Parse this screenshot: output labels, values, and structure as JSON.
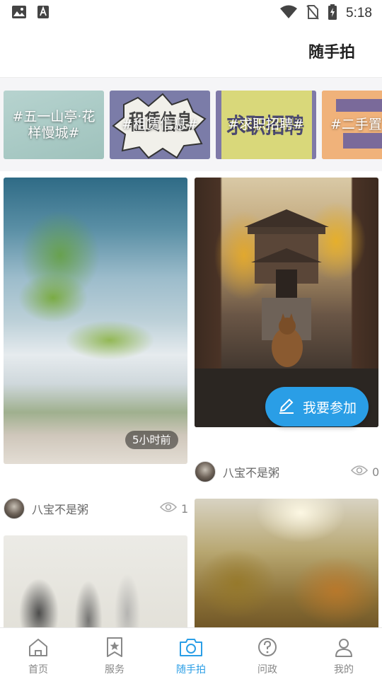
{
  "status_bar": {
    "time": "5:18"
  },
  "header": {
    "title": "随手拍"
  },
  "topics": [
    {
      "label": "#五一山亭·花样慢城#"
    },
    {
      "label": "#租赁信息#",
      "art_text": "租赁信息"
    },
    {
      "label": "#求职招聘#",
      "art_text": "求职招聘"
    },
    {
      "label": "#二手置"
    }
  ],
  "posts": [
    {
      "time": "5小时前",
      "author": "八宝不是粥",
      "views": "1"
    },
    {
      "author": "八宝不是粥",
      "views": "0"
    }
  ],
  "join_button": {
    "label": "我要参加"
  },
  "tabs": [
    {
      "label": "首页",
      "icon": "home-icon"
    },
    {
      "label": "服务",
      "icon": "star-bookmark-icon"
    },
    {
      "label": "随手拍",
      "icon": "camera-icon",
      "active": true
    },
    {
      "label": "问政",
      "icon": "question-icon"
    },
    {
      "label": "我的",
      "icon": "user-icon"
    }
  ],
  "colors": {
    "accent": "#2a9ee6",
    "tab_inactive": "#888888"
  }
}
